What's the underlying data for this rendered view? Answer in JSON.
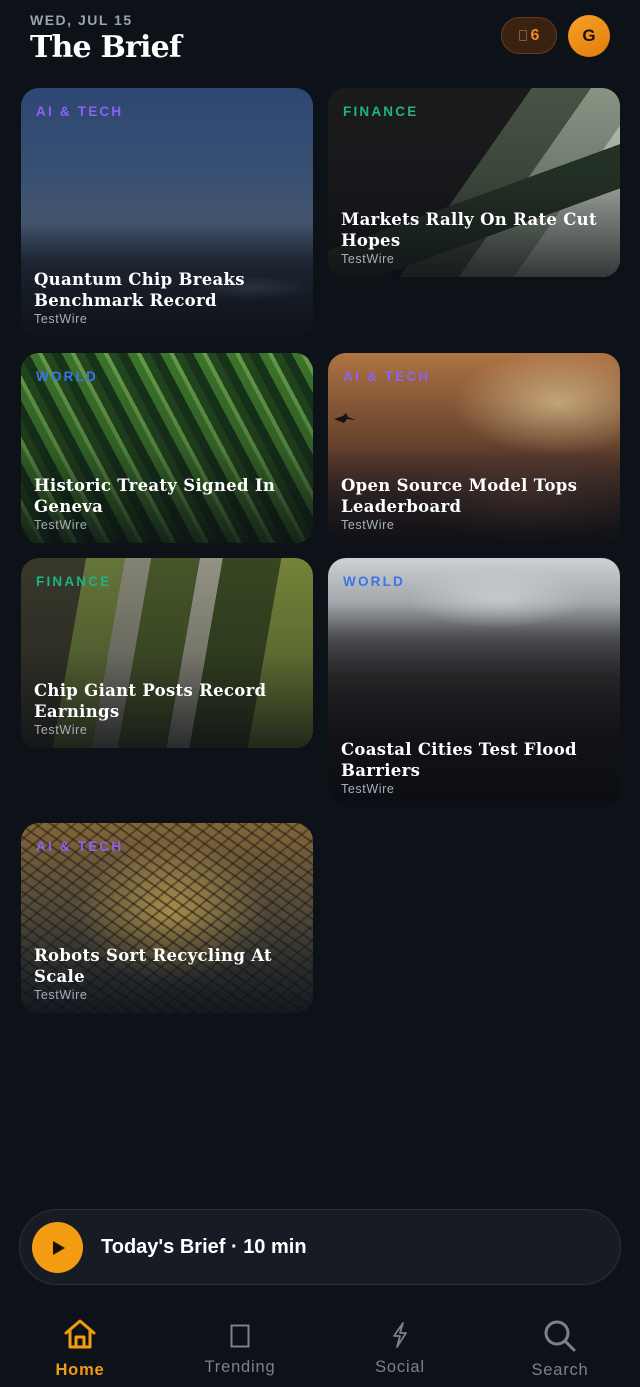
{
  "header": {
    "date": "WED, JUL 15",
    "title": "The Brief",
    "streak_count": "6",
    "streak_icon": "book-icon",
    "avatar_initial": "G"
  },
  "colors": {
    "accent": "#f39c12",
    "category_ai": "#8a63f2",
    "category_finance": "#1db47e",
    "category_world": "#3d73e8"
  },
  "cards": [
    {
      "category": "AI & TECH",
      "headline": "Quantum Chip Breaks Benchmark Record",
      "source": "TestWire"
    },
    {
      "category": "FINANCE",
      "headline": "Markets Rally On Rate Cut Hopes",
      "source": "TestWire"
    },
    {
      "category": "WORLD",
      "headline": "Historic Treaty Signed In Geneva",
      "source": "TestWire"
    },
    {
      "category": "AI & TECH",
      "headline": "Open Source Model Tops Leaderboard",
      "source": "TestWire"
    },
    {
      "category": "FINANCE",
      "headline": "Chip Giant Posts Record Earnings",
      "source": "TestWire"
    },
    {
      "category": "WORLD",
      "headline": "Coastal Cities Test Flood Barriers",
      "source": "TestWire"
    },
    {
      "category": "AI & TECH",
      "headline": "Robots Sort Recycling At Scale",
      "source": "TestWire"
    }
  ],
  "player": {
    "label": "Today's Brief · 10 min",
    "icon": "play-icon"
  },
  "tabs": [
    {
      "label": "Home",
      "icon": "home-icon",
      "active": true
    },
    {
      "label": "Trending",
      "icon": "square-icon"
    },
    {
      "label": "Social",
      "icon": "bolt-icon"
    },
    {
      "label": "Search",
      "icon": "search-icon"
    }
  ]
}
